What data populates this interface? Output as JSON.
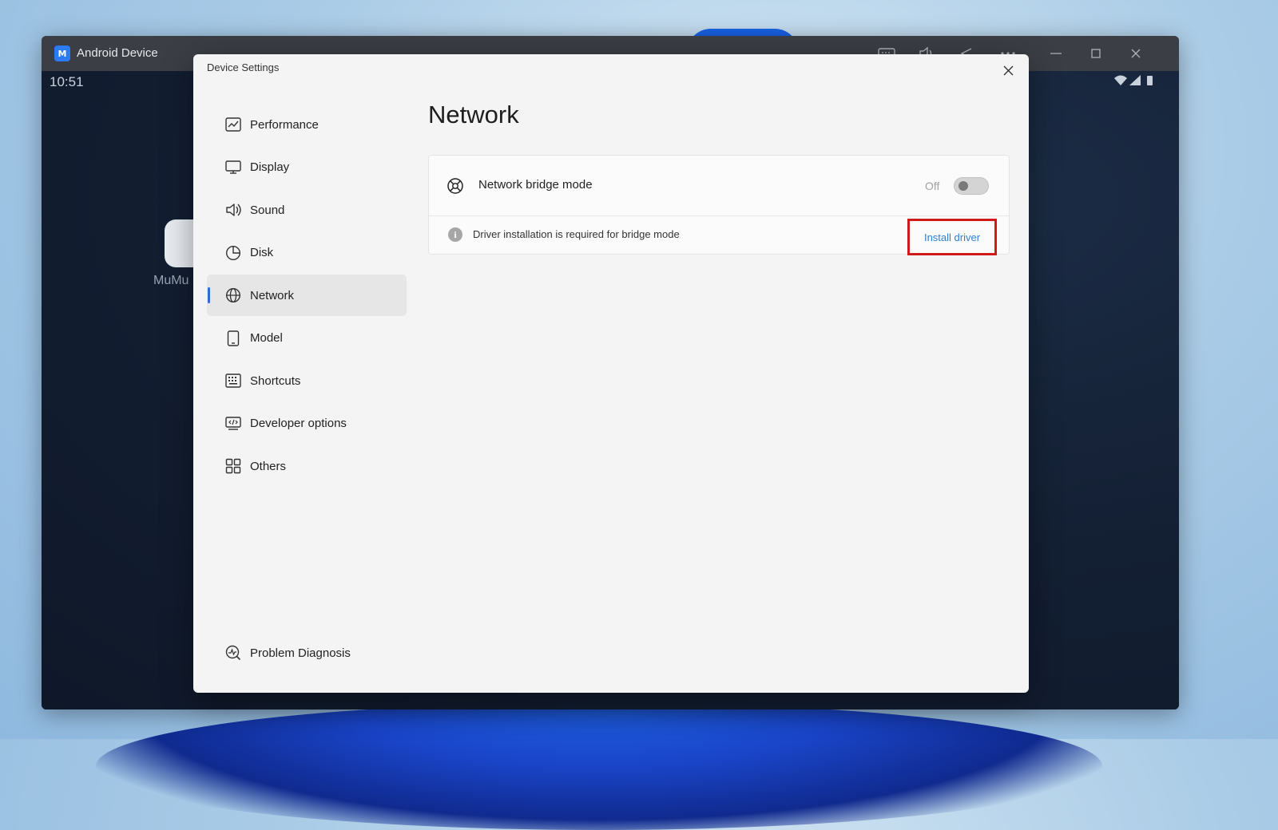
{
  "android_window": {
    "title": "Android Device",
    "logo_text": "M",
    "clock": "10:51",
    "app_label": "MuMu"
  },
  "dialog": {
    "title": "Device Settings",
    "nav_items": [
      {
        "label": "Performance",
        "icon": "performance-icon"
      },
      {
        "label": "Display",
        "icon": "display-icon"
      },
      {
        "label": "Sound",
        "icon": "sound-icon"
      },
      {
        "label": "Disk",
        "icon": "disk-icon"
      },
      {
        "label": "Network",
        "icon": "network-icon",
        "active": true
      },
      {
        "label": "Model",
        "icon": "model-icon"
      },
      {
        "label": "Shortcuts",
        "icon": "shortcuts-icon"
      },
      {
        "label": "Developer options",
        "icon": "developer-options-icon"
      },
      {
        "label": "Others",
        "icon": "others-icon"
      }
    ],
    "bottom_item": {
      "label": "Problem Diagnosis",
      "icon": "problem-diagnosis-icon"
    }
  },
  "network": {
    "title": "Network",
    "bridge_label": "Network bridge mode",
    "bridge_state": "Off",
    "info_text": "Driver installation is required for bridge mode",
    "install_link": "Install driver"
  },
  "colors": {
    "accent": "#2b6fd6",
    "link": "#2f7fd4",
    "highlight_box": "#d11a1a"
  }
}
